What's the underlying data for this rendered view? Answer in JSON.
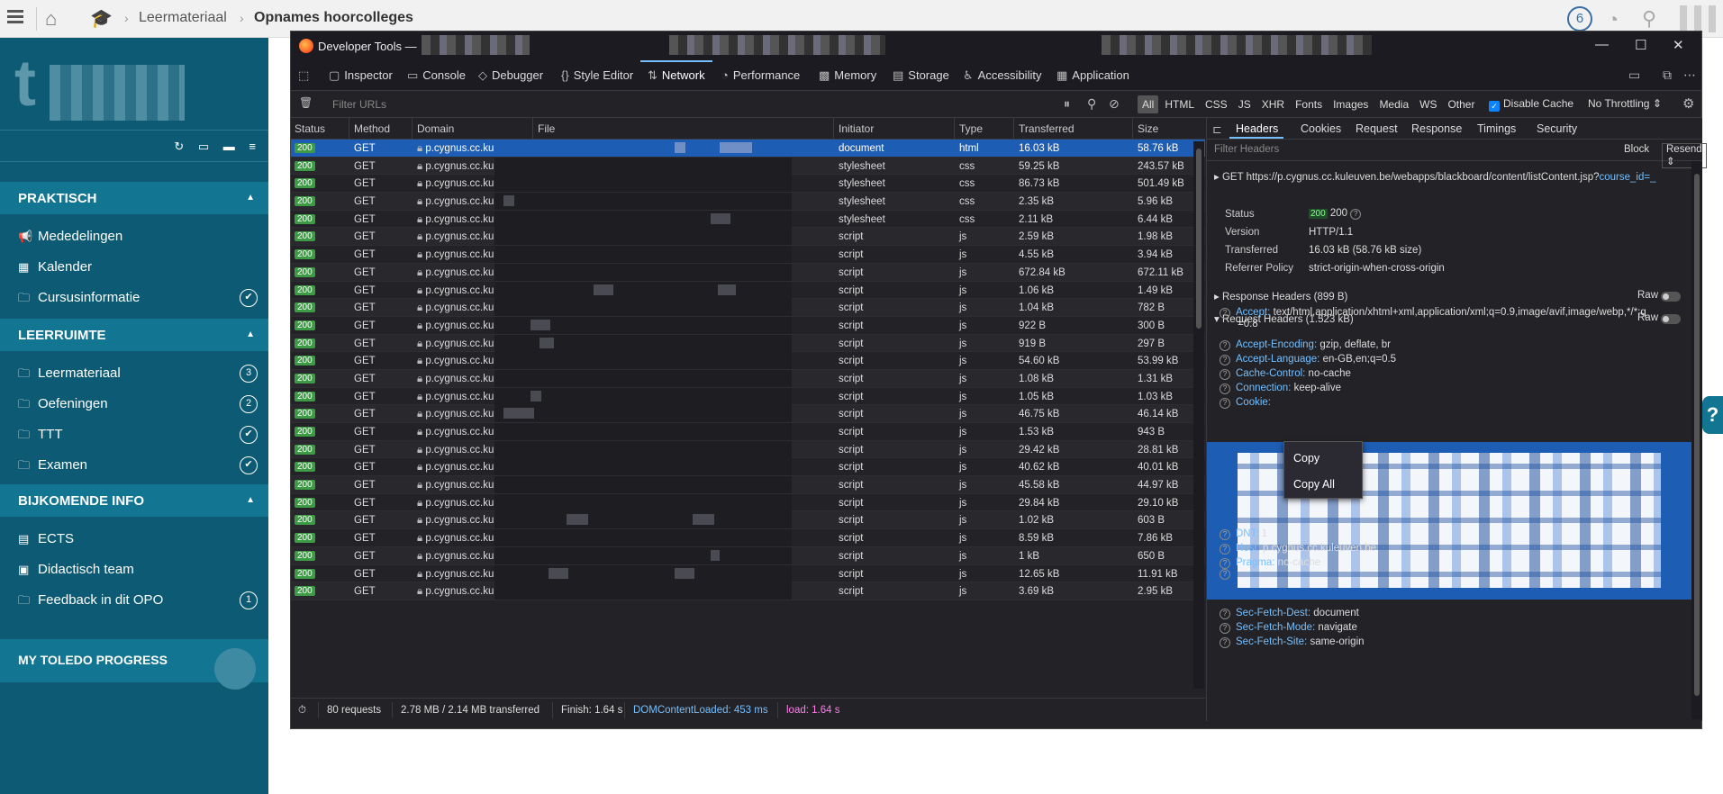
{
  "topbar": {
    "breadcrumb_1": "Leermateriaal",
    "breadcrumb_2": "Opnames hoorcolleges",
    "notification_count": "6"
  },
  "sidebar": {
    "sections": [
      {
        "title": "PRAKTISCH",
        "items": [
          {
            "label": "Mededelingen",
            "icon": "megaphone-icon"
          },
          {
            "label": "Kalender",
            "icon": "calendar-icon"
          },
          {
            "label": "Cursusinformatie",
            "icon": "folder-icon",
            "badge": "✔"
          }
        ]
      },
      {
        "title": "LEERRUIMTE",
        "items": [
          {
            "label": "Leermateriaal",
            "icon": "folder-icon",
            "badge": "3"
          },
          {
            "label": "Oefeningen",
            "icon": "folder-icon",
            "badge": "2"
          },
          {
            "label": "TTT",
            "icon": "folder-icon",
            "badge": "✔"
          },
          {
            "label": "Examen",
            "icon": "folder-icon",
            "badge": "✔"
          }
        ]
      },
      {
        "title": "BIJKOMENDE INFO",
        "items": [
          {
            "label": "ECTS",
            "icon": "book-icon"
          },
          {
            "label": "Didactisch team",
            "icon": "id-card-icon"
          },
          {
            "label": "Feedback in dit OPO",
            "icon": "folder-icon",
            "badge": "1"
          }
        ]
      }
    ],
    "progress_label": "MY TOLEDO PROGRESS"
  },
  "devtools": {
    "window_title": "Developer Tools —",
    "tabs": [
      "Inspector",
      "Console",
      "Debugger",
      "Style Editor",
      "Network",
      "Performance",
      "Memory",
      "Storage",
      "Accessibility",
      "Application"
    ],
    "active_tab": "Network",
    "filter_urls_placeholder": "Filter URLs",
    "type_filters": [
      "All",
      "HTML",
      "CSS",
      "JS",
      "XHR",
      "Fonts",
      "Images",
      "Media",
      "WS",
      "Other"
    ],
    "disable_cache_label": "Disable Cache",
    "throttling_label": "No Throttling ⇕",
    "columns": [
      "Status",
      "Method",
      "Domain",
      "File",
      "Initiator",
      "Type",
      "Transferred",
      "Size"
    ],
    "requests": [
      {
        "status": "200",
        "method": "GET",
        "domain": "p.cygnus.cc.kuleuv...",
        "initiator": "document",
        "type": "html",
        "transferred": "16.03 kB",
        "size": "58.76 kB"
      },
      {
        "status": "200",
        "method": "GET",
        "domain": "p.cygnus.cc.kuleuv...",
        "initiator": "stylesheet",
        "type": "css",
        "transferred": "59.25 kB",
        "size": "243.57 kB"
      },
      {
        "status": "200",
        "method": "GET",
        "domain": "p.cygnus.cc.kuleuv...",
        "initiator": "stylesheet",
        "type": "css",
        "transferred": "86.73 kB",
        "size": "501.49 kB"
      },
      {
        "status": "200",
        "method": "GET",
        "domain": "p.cygnus.cc.kuleuv...",
        "initiator": "stylesheet",
        "type": "css",
        "transferred": "2.35 kB",
        "size": "5.96 kB"
      },
      {
        "status": "200",
        "method": "GET",
        "domain": "p.cygnus.cc.kuleuv...",
        "initiator": "stylesheet",
        "type": "css",
        "transferred": "2.11 kB",
        "size": "6.44 kB"
      },
      {
        "status": "200",
        "method": "GET",
        "domain": "p.cygnus.cc.kuleuv...",
        "initiator": "script",
        "type": "js",
        "transferred": "2.59 kB",
        "size": "1.98 kB"
      },
      {
        "status": "200",
        "method": "GET",
        "domain": "p.cygnus.cc.kuleuv...",
        "initiator": "script",
        "type": "js",
        "transferred": "4.55 kB",
        "size": "3.94 kB"
      },
      {
        "status": "200",
        "method": "GET",
        "domain": "p.cygnus.cc.kuleuv...",
        "initiator": "script",
        "type": "js",
        "transferred": "672.84 kB",
        "size": "672.11 kB"
      },
      {
        "status": "200",
        "method": "GET",
        "domain": "p.cygnus.cc.kuleuv...",
        "initiator": "script",
        "type": "js",
        "transferred": "1.06 kB",
        "size": "1.49 kB"
      },
      {
        "status": "200",
        "method": "GET",
        "domain": "p.cygnus.cc.kuleuv...",
        "initiator": "script",
        "type": "js",
        "transferred": "1.04 kB",
        "size": "782 B"
      },
      {
        "status": "200",
        "method": "GET",
        "domain": "p.cygnus.cc.kuleuv...",
        "initiator": "script",
        "type": "js",
        "transferred": "922 B",
        "size": "300 B"
      },
      {
        "status": "200",
        "method": "GET",
        "domain": "p.cygnus.cc.kuleuv...",
        "initiator": "script",
        "type": "js",
        "transferred": "919 B",
        "size": "297 B"
      },
      {
        "status": "200",
        "method": "GET",
        "domain": "p.cygnus.cc.kuleuv...",
        "initiator": "script",
        "type": "js",
        "transferred": "54.60 kB",
        "size": "53.99 kB"
      },
      {
        "status": "200",
        "method": "GET",
        "domain": "p.cygnus.cc.kuleuv...",
        "initiator": "script",
        "type": "js",
        "transferred": "1.08 kB",
        "size": "1.31 kB"
      },
      {
        "status": "200",
        "method": "GET",
        "domain": "p.cygnus.cc.kuleuv...",
        "initiator": "script",
        "type": "js",
        "transferred": "1.05 kB",
        "size": "1.03 kB"
      },
      {
        "status": "200",
        "method": "GET",
        "domain": "p.cygnus.cc.kuleuv...",
        "initiator": "script",
        "type": "js",
        "transferred": "46.75 kB",
        "size": "46.14 kB"
      },
      {
        "status": "200",
        "method": "GET",
        "domain": "p.cygnus.cc.kuleuv...",
        "initiator": "script",
        "type": "js",
        "transferred": "1.53 kB",
        "size": "943 B"
      },
      {
        "status": "200",
        "method": "GET",
        "domain": "p.cygnus.cc.kuleuv...",
        "initiator": "script",
        "type": "js",
        "transferred": "29.42 kB",
        "size": "28.81 kB"
      },
      {
        "status": "200",
        "method": "GET",
        "domain": "p.cygnus.cc.kuleuv...",
        "initiator": "script",
        "type": "js",
        "transferred": "40.62 kB",
        "size": "40.01 kB"
      },
      {
        "status": "200",
        "method": "GET",
        "domain": "p.cygnus.cc.kuleuv...",
        "initiator": "script",
        "type": "js",
        "transferred": "45.58 kB",
        "size": "44.97 kB"
      },
      {
        "status": "200",
        "method": "GET",
        "domain": "p.cygnus.cc.kuleuv...",
        "initiator": "script",
        "type": "js",
        "transferred": "29.84 kB",
        "size": "29.10 kB"
      },
      {
        "status": "200",
        "method": "GET",
        "domain": "p.cygnus.cc.kuleuv...",
        "initiator": "script",
        "type": "js",
        "transferred": "1.02 kB",
        "size": "603 B"
      },
      {
        "status": "200",
        "method": "GET",
        "domain": "p.cygnus.cc.kuleuv...",
        "initiator": "script",
        "type": "js",
        "transferred": "8.59 kB",
        "size": "7.86 kB"
      },
      {
        "status": "200",
        "method": "GET",
        "domain": "p.cygnus.cc.kuleuv...",
        "initiator": "script",
        "type": "js",
        "transferred": "1 kB",
        "size": "650 B"
      },
      {
        "status": "200",
        "method": "GET",
        "domain": "p.cygnus.cc.kuleuv...",
        "initiator": "script",
        "type": "js",
        "transferred": "12.65 kB",
        "size": "11.91 kB"
      },
      {
        "status": "200",
        "method": "GET",
        "domain": "p.cygnus.cc.kuleuv...",
        "initiator": "script",
        "type": "js",
        "transferred": "3.69 kB",
        "size": "2.95 kB"
      }
    ],
    "status": {
      "requests": "80 requests",
      "transferred": "2.78 MB / 2.14 MB transferred",
      "finish": "Finish: 1.64 s",
      "dom": "DOMContentLoaded: 453 ms",
      "load": "load: 1.64 s"
    },
    "details": {
      "tabs": [
        "Headers",
        "Cookies",
        "Request",
        "Response",
        "Timings",
        "Security"
      ],
      "filter_placeholder": "Filter Headers",
      "block_label": "Block",
      "resend_label": "Resend ⇕",
      "request_line_method": "GET",
      "request_line_url": "https://p.cygnus.cc.kuleuven.be/webapps/blackboard/content/listContent.jsp?",
      "request_line_param": "course_id=_",
      "status_label": "Status",
      "status_code": "200",
      "status_value": "200",
      "version_label": "Version",
      "version_value": "HTTP/1.1",
      "transferred_label": "Transferred",
      "transferred_value": "16.03 kB (58.76 kB size)",
      "referrer_label": "Referrer Policy",
      "referrer_value": "strict-origin-when-cross-origin",
      "response_headers": "Response Headers (899 B)",
      "request_headers": "Request Headers (1.523 kB)",
      "raw_label": "Raw",
      "headers": [
        {
          "key": "Accept:",
          "value": "text/html,application/xhtml+xml,application/xml;q=0.9,image/avif,image/webp,*/*;q",
          "cont": "=0.8"
        },
        {
          "key": "Accept-Encoding:",
          "value": "gzip, deflate, br"
        },
        {
          "key": "Accept-Language:",
          "value": "en-GB,en;q=0.5"
        },
        {
          "key": "Cache-Control:",
          "value": "no-cache"
        },
        {
          "key": "Connection:",
          "value": "keep-alive"
        },
        {
          "key": "Cookie:",
          "value": ""
        },
        {
          "key": "DNT:",
          "value": "1"
        },
        {
          "key": "Host:",
          "value": "p.cygnus.cc.kuleuven.be"
        },
        {
          "key": "Pragma:",
          "value": "no-cache"
        },
        {
          "key": "Sec-Fetch-Dest:",
          "value": "document"
        },
        {
          "key": "Sec-Fetch-Mode:",
          "value": "navigate"
        },
        {
          "key": "Sec-Fetch-Site:",
          "value": "same-origin"
        }
      ]
    },
    "context_menu": [
      "Copy",
      "Copy All"
    ]
  },
  "help_button": "?"
}
